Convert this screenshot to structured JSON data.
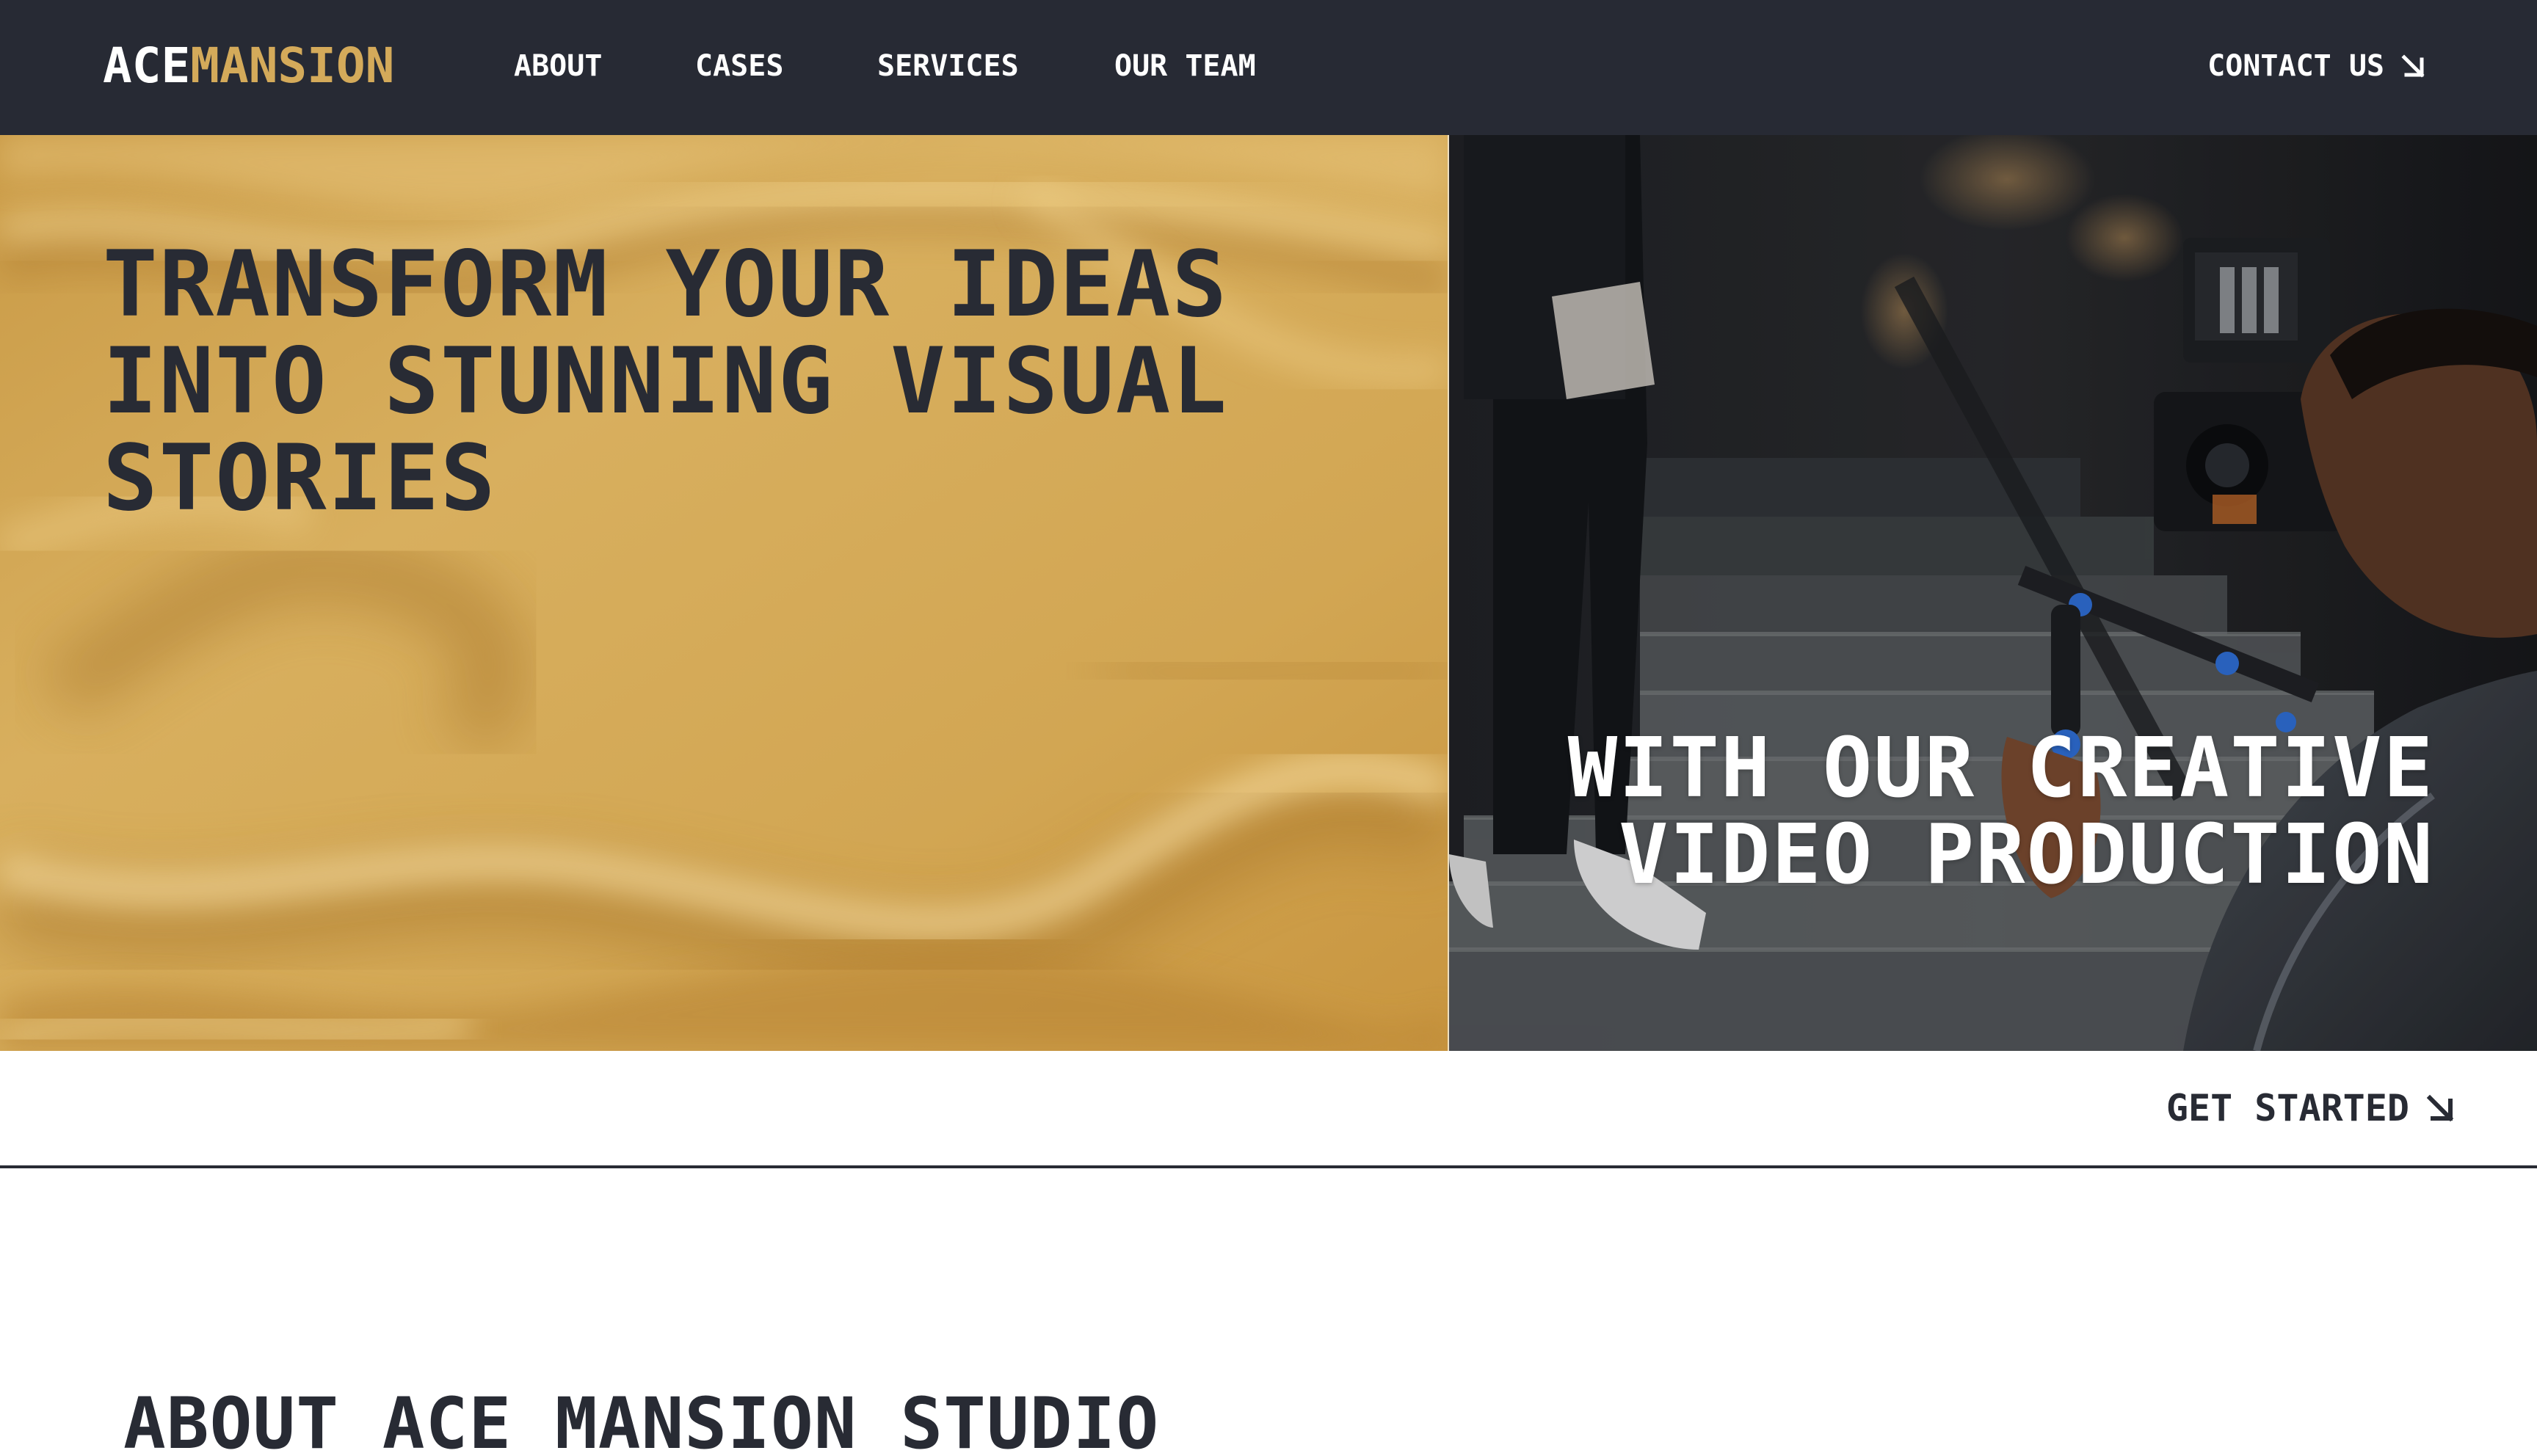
{
  "brand": {
    "part1": "ACE",
    "part2": "MANSION",
    "color_primary": "#ffffff",
    "color_accent": "#d4aa5a"
  },
  "nav": {
    "items": [
      {
        "label": "ABOUT"
      },
      {
        "label": "CASES"
      },
      {
        "label": "SERVICES"
      },
      {
        "label": "OUR TEAM"
      }
    ],
    "contact_label": "CONTACT US",
    "contact_icon": "arrow-down-right-icon",
    "background": "#272a34"
  },
  "hero": {
    "title": "TRANSFORM YOUR IDEAS INTO STUNNING VISUAL STORIES",
    "subtitle": "WITH OUR CREATIVE VIDEO PRODUCTION",
    "left_background": "#d3a957"
  },
  "cta": {
    "label": "GET STARTED",
    "icon": "arrow-down-right-icon"
  },
  "about": {
    "title": "ABOUT ACE MANSION STUDIO"
  },
  "colors": {
    "dark_text": "#282b34",
    "gold": "#d3a957"
  }
}
